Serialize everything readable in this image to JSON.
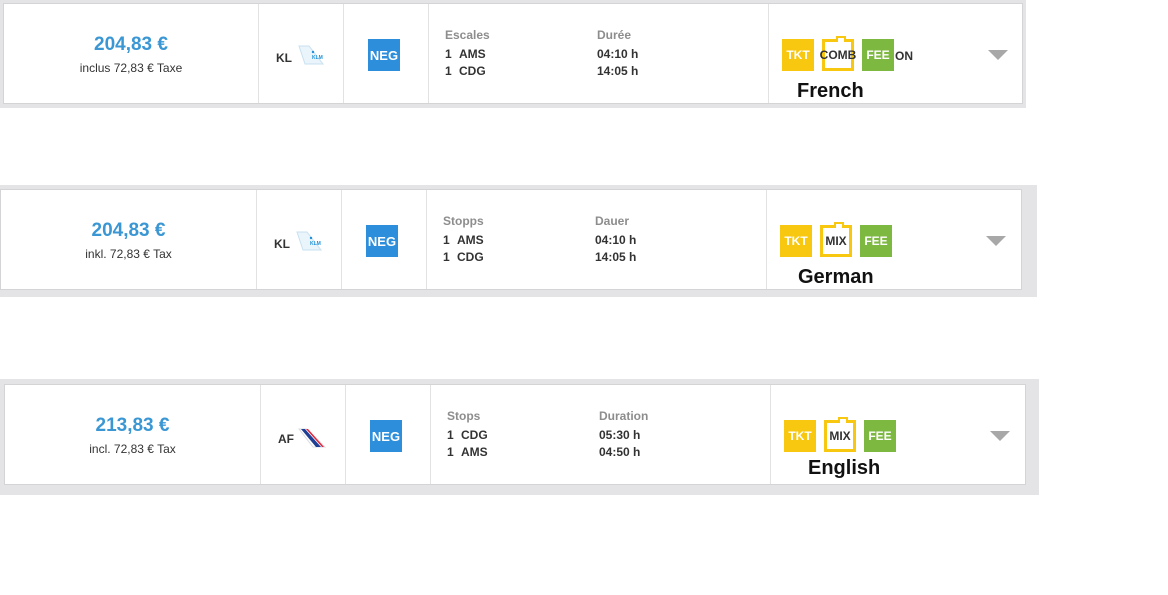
{
  "cards": [
    {
      "id": "french",
      "price": "204,83 €",
      "tax": "inclus 72,83 € Taxe",
      "airline_code": "KL",
      "airline_logo": "klm-tail-icon",
      "negotiated_badge": "NEG",
      "stops_header": "Escales",
      "duration_header": "Durée",
      "segments": [
        {
          "stops": "1",
          "airport": "AMS",
          "duration": "04:10 h"
        },
        {
          "stops": "1",
          "airport": "CDG",
          "duration": "14:05 h"
        }
      ],
      "tags": {
        "tkt": "TKT",
        "mid": "COMB",
        "fee": "FEE",
        "overflow": "ON"
      },
      "language_label": "French"
    },
    {
      "id": "german",
      "price": "204,83 €",
      "tax": "inkl. 72,83 € Tax",
      "airline_code": "KL",
      "airline_logo": "klm-tail-icon",
      "negotiated_badge": "NEG",
      "stops_header": "Stopps",
      "duration_header": "Dauer",
      "segments": [
        {
          "stops": "1",
          "airport": "AMS",
          "duration": "04:10 h"
        },
        {
          "stops": "1",
          "airport": "CDG",
          "duration": "14:05 h"
        }
      ],
      "tags": {
        "tkt": "TKT",
        "mid": "MIX",
        "fee": "FEE"
      },
      "language_label": "German"
    },
    {
      "id": "english",
      "price": "213,83 €",
      "tax": "incl. 72,83 € Tax",
      "airline_code": "AF",
      "airline_logo": "air-france-tail-icon",
      "negotiated_badge": "NEG",
      "stops_header": "Stops",
      "duration_header": "Duration",
      "segments": [
        {
          "stops": "1",
          "airport": "CDG",
          "duration": "05:30 h"
        },
        {
          "stops": "1",
          "airport": "AMS",
          "duration": "04:50 h"
        }
      ],
      "tags": {
        "tkt": "TKT",
        "mid": "MIX",
        "fee": "FEE"
      },
      "language_label": "English"
    }
  ],
  "colors": {
    "price_blue": "#3a97d4",
    "neg_blue": "#2d8fdb",
    "tag_yellow": "#f7c80f",
    "tag_green": "#7db840",
    "chevron_grey": "#a8a8a8"
  }
}
